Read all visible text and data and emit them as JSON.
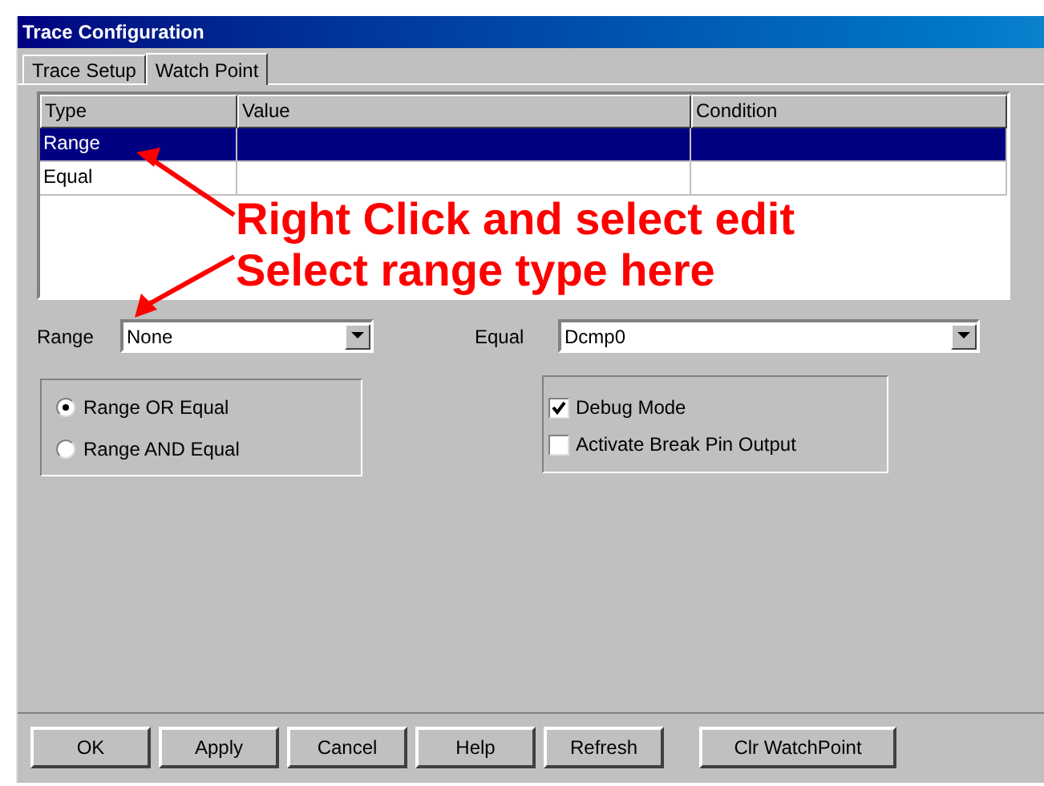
{
  "window": {
    "title": "Trace Configuration"
  },
  "tabs": [
    {
      "label": "Trace Setup",
      "selected": false
    },
    {
      "label": "Watch Point",
      "selected": true
    }
  ],
  "table": {
    "columns": [
      "Type",
      "Value",
      "Condition"
    ],
    "rows": [
      {
        "cells": [
          "Range",
          "",
          ""
        ],
        "selected": true
      },
      {
        "cells": [
          "Equal",
          "",
          ""
        ],
        "selected": false
      }
    ]
  },
  "range": {
    "label": "Range",
    "value": "None"
  },
  "equal": {
    "label": "Equal",
    "value": "Dcmp0"
  },
  "logic": [
    {
      "label": "Range OR Equal",
      "selected": true
    },
    {
      "label": "Range AND Equal",
      "selected": false
    }
  ],
  "options": [
    {
      "label": "Debug Mode",
      "checked": true
    },
    {
      "label": "Activate Break Pin Output",
      "checked": false
    }
  ],
  "buttons": [
    "OK",
    "Apply",
    "Cancel",
    "Help",
    "Refresh",
    "Clr WatchPoint"
  ],
  "annotations": [
    "Right Click and select edit",
    "Select range type here"
  ]
}
